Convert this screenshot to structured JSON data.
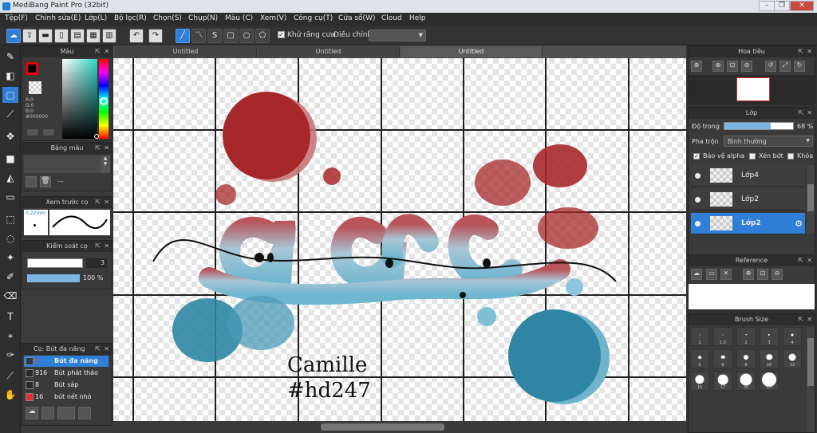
{
  "window": {
    "title": "MediBang Paint Pro (32bit)"
  },
  "menu": [
    "Tệp(F)",
    "Chỉnh sửa(E)",
    "Lớp(L)",
    "Bộ lọc(R)",
    "Chọn(S)",
    "Chụp(N)",
    "Màu (C)",
    "Xem(V)",
    "Công cụ(T)",
    "Cửa sổ(W)",
    "Cloud",
    "Help"
  ],
  "toolbar": {
    "antialias_label": "Khử răng cưa",
    "adjust_label": "Điều chỉnh"
  },
  "color_panel": {
    "title": "Màu",
    "r": "R:0",
    "g": "G:0",
    "b": "B:0",
    "hex": "#000000",
    "fg": "#000000",
    "bg": "#ffffff"
  },
  "palette_panel": {
    "title": "Bảng màu",
    "dash": "---"
  },
  "preview_panel": {
    "title": "Xem trước cọ",
    "size": "0.22mm"
  },
  "control_panel": {
    "title": "Kiểm soát cọ",
    "size": "3",
    "opacity": "100 %"
  },
  "brush_panel": {
    "title": "Cọ: Bút đa năng",
    "items": [
      {
        "num": "3",
        "name": "Bút đa năng",
        "color": "#2a3a4a",
        "selected": true
      },
      {
        "num": "916",
        "name": "Bút phát thảo",
        "color": "#2a2a2a",
        "selected": false
      },
      {
        "num": "8",
        "name": "Bút sáp",
        "color": "#2a2a2a",
        "selected": false
      },
      {
        "num": "16",
        "name": "bút nét nhỏ",
        "color": "#e03030",
        "selected": false
      }
    ]
  },
  "tabs": [
    "Untitled",
    "Untitled",
    "Untitled"
  ],
  "canvas": {
    "text1": "Camille",
    "text2": "#hd247"
  },
  "navigator_panel": {
    "title": "Hoa tiêu"
  },
  "layer_panel": {
    "title": "Lớp",
    "opacity_label": "Độ trong",
    "opacity_value": "68 %",
    "opacity_fill": 0.68,
    "blend_label": "Pha trộn",
    "blend_value": "Bình thường",
    "protect_alpha": "Bảo vệ alpha",
    "clip": "Xén bớt",
    "lock": "Khóa",
    "layers": [
      {
        "name": "Lớp4",
        "selected": false
      },
      {
        "name": "Lớp2",
        "selected": false
      },
      {
        "name": "Lớp2",
        "selected": true
      }
    ]
  },
  "reference_panel": {
    "title": "Reference"
  },
  "brushsize_panel": {
    "title": "Brush Size",
    "sizes": [
      "1",
      "1.5",
      "2",
      "3",
      "4",
      "5",
      "6",
      "8",
      "10",
      "12",
      "15",
      "17",
      "20",
      "25"
    ]
  },
  "colors": {
    "accent": "#2f7fd6",
    "red": "#a7282b",
    "blue": "#2f86a4",
    "light_blue": "#7fbfd6"
  }
}
